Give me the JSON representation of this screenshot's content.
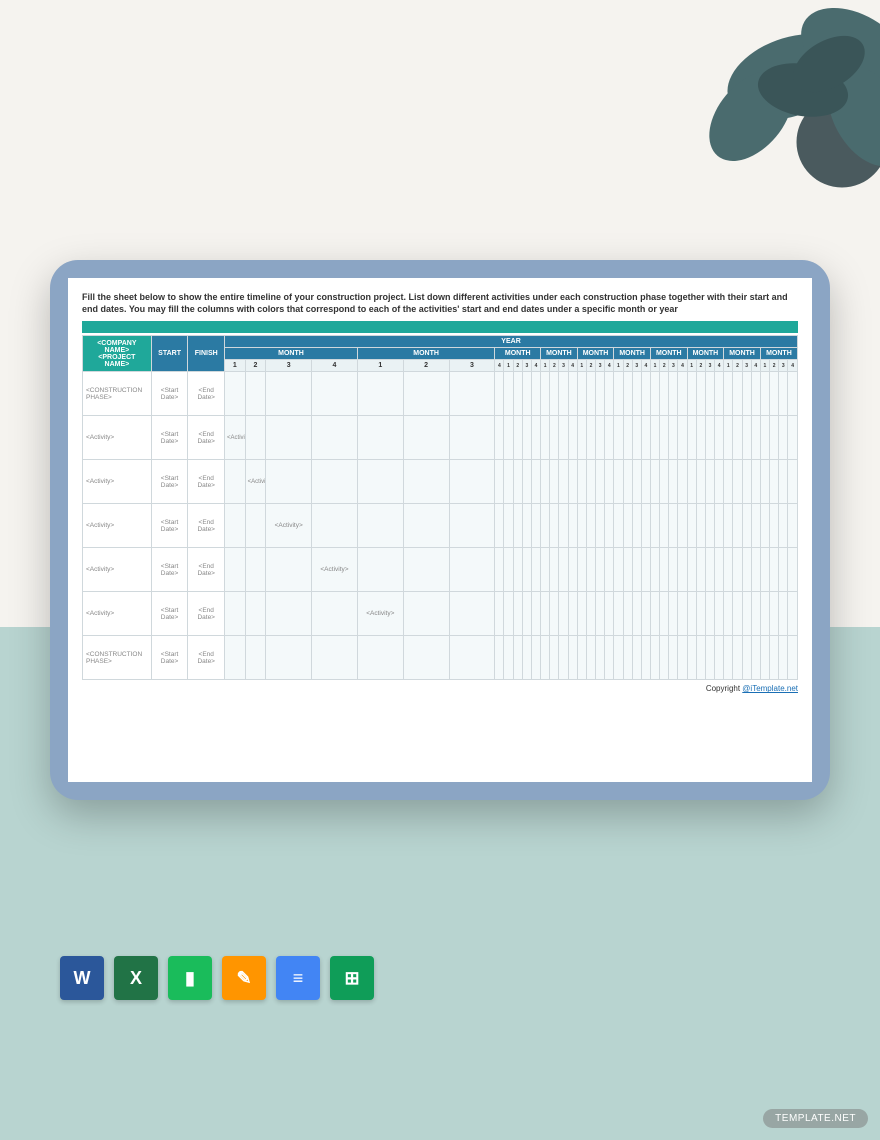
{
  "instructions": "Fill the sheet below to show the entire timeline of your construction project. List down different activities under each construction phase together with their start and end dates. You may fill the columns with colors that correspond to each of the activities' start and end dates under a specific month or year",
  "headers": {
    "company": "<COMPANY NAME> <PROJECT NAME>",
    "start": "START",
    "finish": "FINISH",
    "year": "YEAR",
    "month": "MONTH"
  },
  "weeks": [
    "1",
    "2",
    "3",
    "4"
  ],
  "smallWeeks": [
    "4",
    "1",
    "2",
    "3",
    "4",
    "1",
    "2",
    "3",
    "4",
    "1",
    "2",
    "3",
    "4",
    "1",
    "2",
    "3",
    "4",
    "1",
    "2",
    "3",
    "4",
    "1",
    "2",
    "3",
    "4",
    "1",
    "2",
    "3",
    "4",
    "1",
    "2",
    "3",
    "4"
  ],
  "rows": [
    {
      "label": "<CONSTRUCTION PHASE>",
      "start": "<Start Date>",
      "end": "<End Date>",
      "activityCol": -1
    },
    {
      "label": "<Activity>",
      "start": "<Start Date>",
      "end": "<End Date>",
      "activityCol": 0
    },
    {
      "label": "<Activity>",
      "start": "<Start Date>",
      "end": "<End Date>",
      "activityCol": 1
    },
    {
      "label": "<Activity>",
      "start": "<Start Date>",
      "end": "<End Date>",
      "activityCol": 2
    },
    {
      "label": "<Activity>",
      "start": "<Start Date>",
      "end": "<End Date>",
      "activityCol": 3
    },
    {
      "label": "<Activity>",
      "start": "<Start Date>",
      "end": "<End Date>",
      "activityCol": 4
    },
    {
      "label": "<CONSTRUCTION PHASE>",
      "start": "<Start Date>",
      "end": "<End Date>",
      "activityCol": -1
    }
  ],
  "activityText": "<Activity>",
  "copyright": {
    "prefix": "Copyright ",
    "link": "@iTemplate.net"
  },
  "apps": [
    {
      "name": "word",
      "bg": "#2b579a",
      "glyph": "W"
    },
    {
      "name": "excel",
      "bg": "#217346",
      "glyph": "X"
    },
    {
      "name": "numbers",
      "bg": "#1abc5b",
      "glyph": "▮"
    },
    {
      "name": "pages",
      "bg": "#ff9500",
      "glyph": "✎"
    },
    {
      "name": "docs",
      "bg": "#4285f4",
      "glyph": "≡"
    },
    {
      "name": "sheets",
      "bg": "#0f9d58",
      "glyph": "⊞"
    }
  ],
  "watermark": "TEMPLATE.NET"
}
